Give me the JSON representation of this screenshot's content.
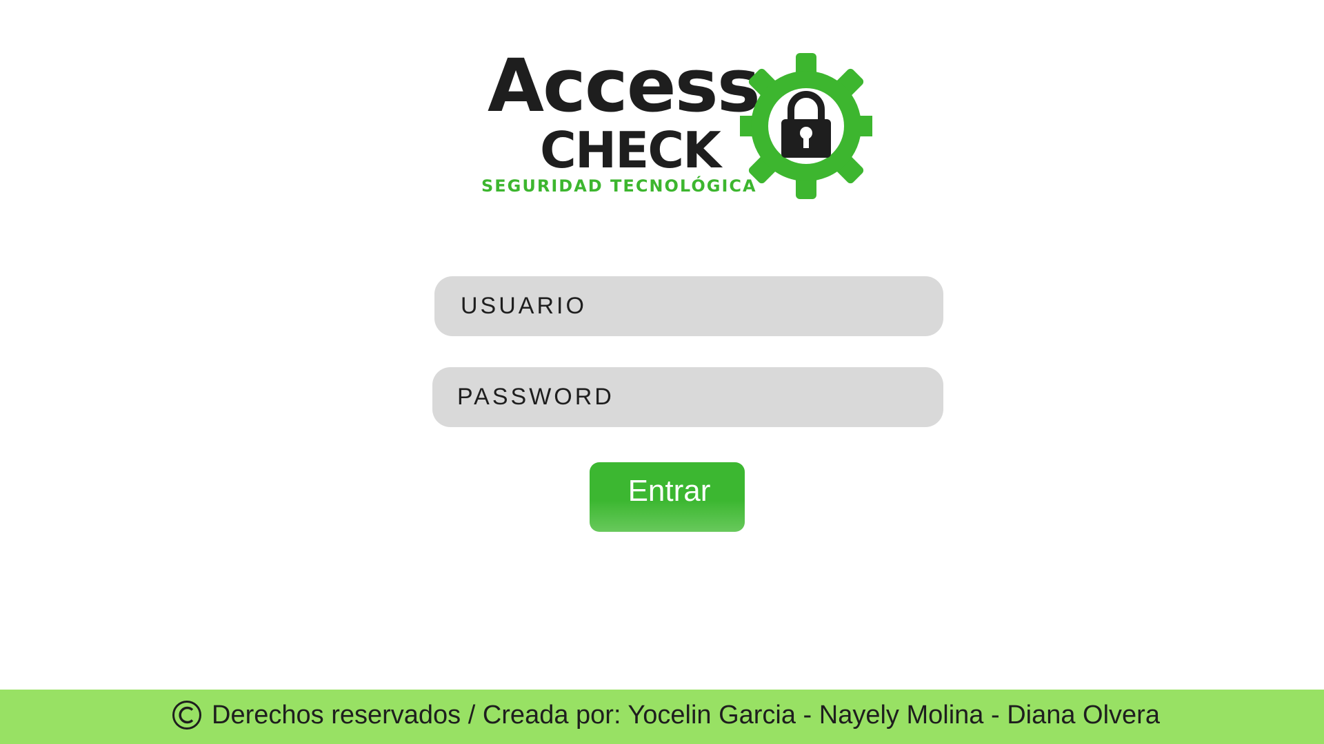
{
  "logo": {
    "line1": "Access",
    "line2": "CHECK",
    "tagline": "SEGURIDAD TECNOLÓGICA",
    "icon": "gear-with-padlock"
  },
  "login_form": {
    "username_placeholder": "USUARIO",
    "password_placeholder": "PASSWORD",
    "submit_label": "Entrar"
  },
  "footer": {
    "icon": "copyright-icon",
    "text": "Derechos reservados / Creada por: Yocelin Garcia - Nayely Molina - Diana Olvera"
  },
  "colors": {
    "brand_green": "#3db62f",
    "footer_green": "#98e164",
    "field_gray": "#d9d9d9",
    "text_dark": "#1e1e1e"
  }
}
